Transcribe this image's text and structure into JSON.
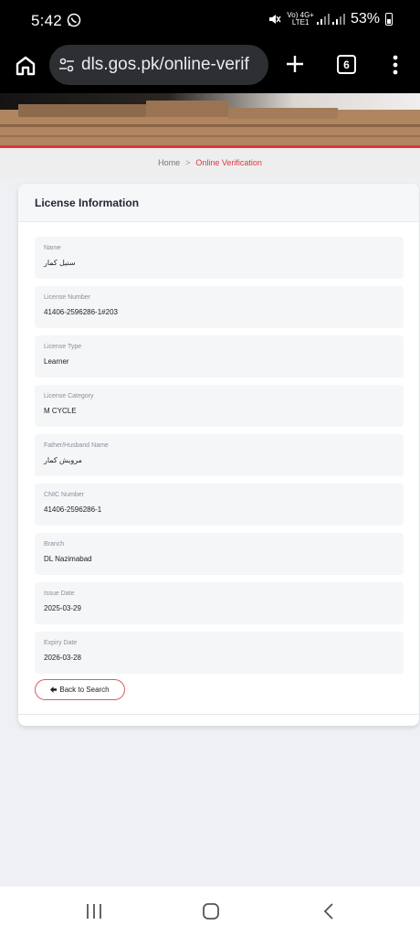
{
  "status_bar": {
    "time": "5:42",
    "network_label": "Vo) 4G+",
    "network_sub": "LTE1",
    "battery": "53%"
  },
  "browser": {
    "url": "dls.gos.pk/online-verif",
    "tab_count": "6"
  },
  "breadcrumb": {
    "home": "Home",
    "separator": ">",
    "current": "Online Verification"
  },
  "card": {
    "title": "License Information",
    "fields": [
      {
        "label": "Name",
        "value": "سنیل کمار"
      },
      {
        "label": "License Number",
        "value": "41406-2596286-1#203"
      },
      {
        "label": "License Type",
        "value": "Learner"
      },
      {
        "label": "License Category",
        "value": "M CYCLE"
      },
      {
        "label": "Father/Husband Name",
        "value": "مرویش کمار"
      },
      {
        "label": "CNIC Number",
        "value": "41406-2596286-1"
      },
      {
        "label": "Branch",
        "value": "DL Nazimabad"
      },
      {
        "label": "Issue Date",
        "value": "2025-03-29"
      },
      {
        "label": "Expiry Date",
        "value": "2026-03-28"
      }
    ],
    "back_button": "Back to Search"
  },
  "colors": {
    "accent_red": "#e0343c",
    "page_bg": "#eef0f4",
    "field_bg": "#f5f6f8"
  }
}
